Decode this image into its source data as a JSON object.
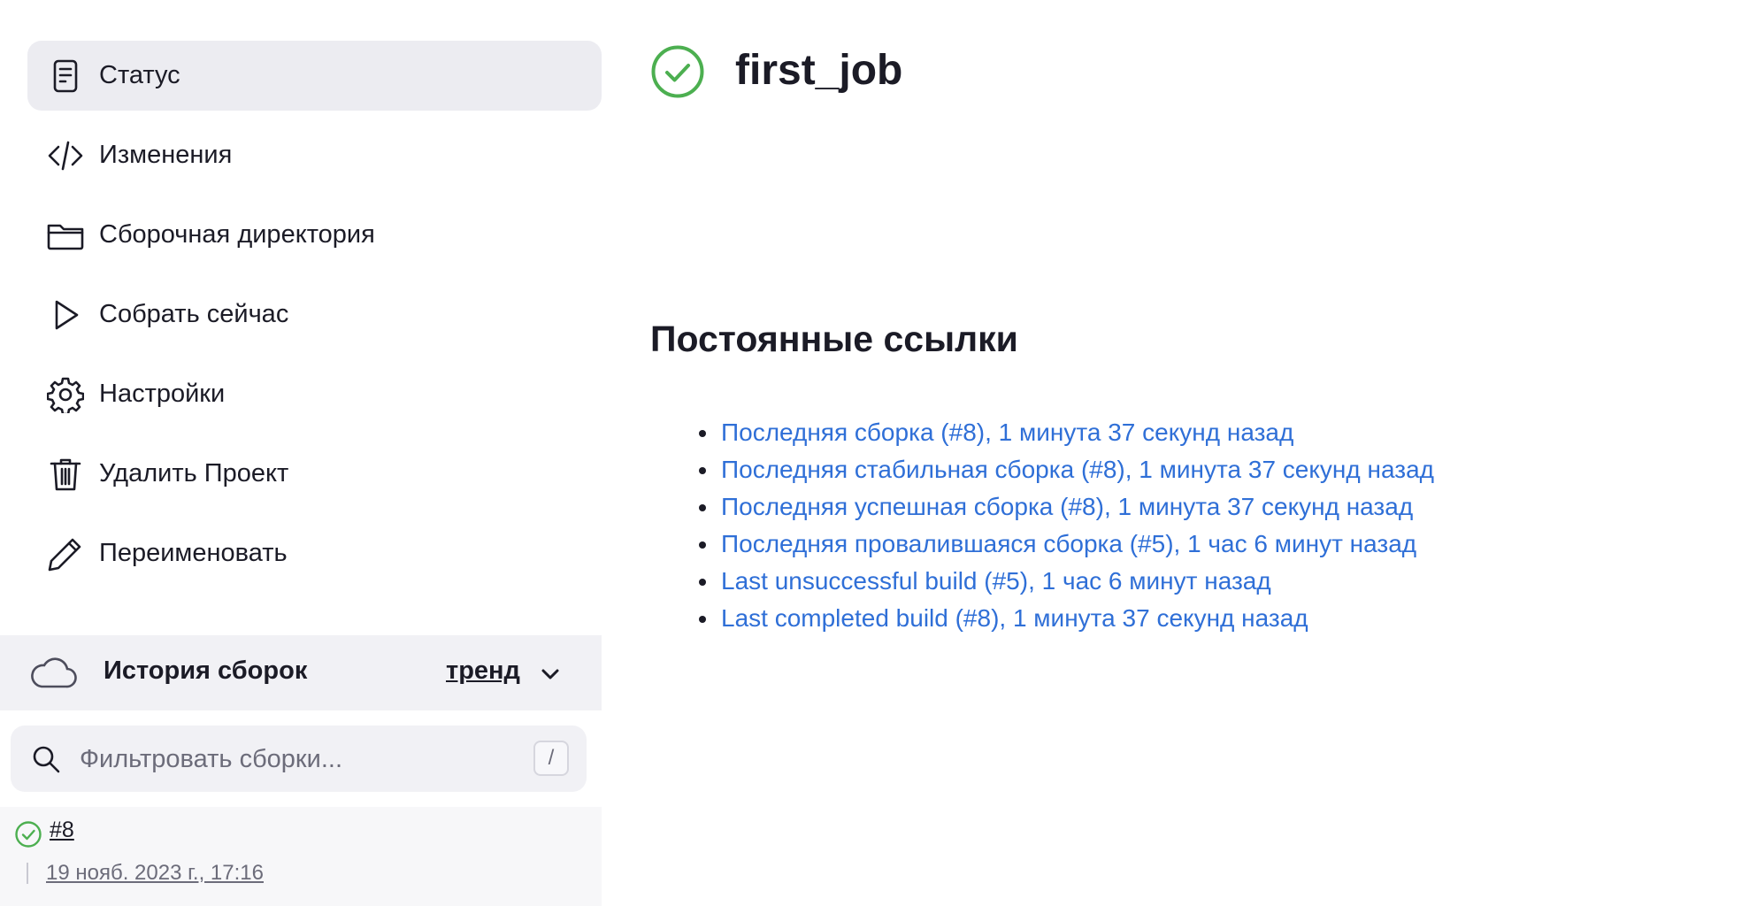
{
  "sidebar": {
    "tasks": [
      {
        "label": "Статус",
        "icon": "document-icon",
        "active": true
      },
      {
        "label": "Изменения",
        "icon": "code-icon"
      },
      {
        "label": "Сборочная директория",
        "icon": "folder-icon"
      },
      {
        "label": "Собрать сейчас",
        "icon": "play-icon"
      },
      {
        "label": "Настройки",
        "icon": "gear-icon"
      },
      {
        "label": "Удалить Проект",
        "icon": "trash-icon"
      },
      {
        "label": "Переименовать",
        "icon": "pencil-icon"
      }
    ]
  },
  "build_history": {
    "title": "История сборок",
    "trend_label": "тренд",
    "filter_placeholder": "Фильтровать сборки...",
    "shortcut_key": "/",
    "builds": [
      {
        "number": "#8",
        "time": "19 нояб. 2023 г., 17:16",
        "status": "success"
      }
    ]
  },
  "job": {
    "name": "first_job",
    "status": "success"
  },
  "permalinks": {
    "title": "Постоянные ссылки",
    "items": [
      "Последняя сборка (#8), 1 минута 37 секунд назад",
      "Последняя стабильная сборка (#8), 1 минута 37 секунд назад",
      "Последняя успешная сборка (#8), 1 минута 37 секунд назад",
      "Последняя провалившаяся сборка (#5), 1 час 6 минут назад",
      "Last unsuccessful build (#5), 1 час 6 минут назад",
      "Last completed build (#8), 1 минута 37 секунд назад"
    ]
  },
  "colors": {
    "success": "#4caf50",
    "link": "#2f6fd7",
    "active_bg": "#ececf1"
  }
}
